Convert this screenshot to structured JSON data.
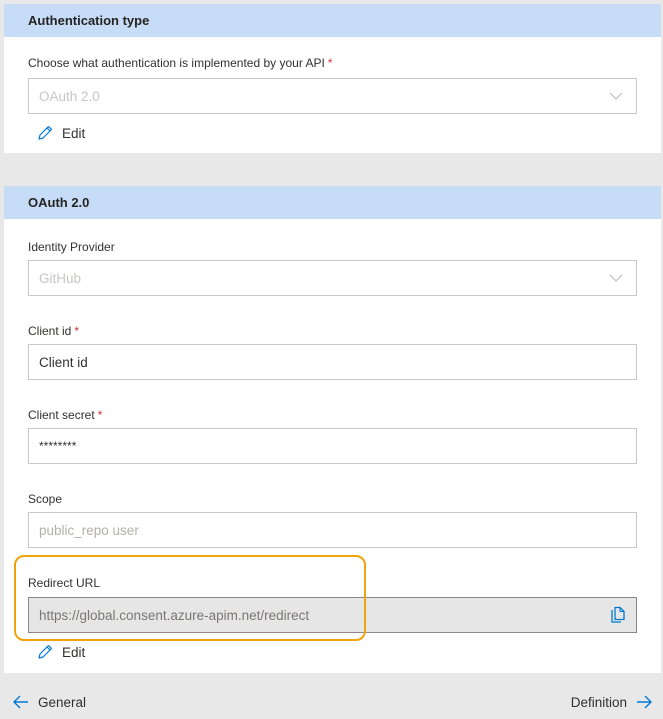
{
  "auth_section": {
    "title": "Authentication type",
    "label": "Choose what authentication is implemented by your API",
    "required_mark": "*",
    "selected_value": "OAuth 2.0",
    "edit_label": "Edit"
  },
  "oauth_section": {
    "title": "OAuth 2.0",
    "identity_provider": {
      "label": "Identity Provider",
      "value": "GitHub"
    },
    "client_id": {
      "label": "Client id",
      "required_mark": "*",
      "value": "Client id"
    },
    "client_secret": {
      "label": "Client secret",
      "required_mark": "*",
      "value": "********"
    },
    "scope": {
      "label": "Scope",
      "placeholder": "public_repo user"
    },
    "redirect_url": {
      "label": "Redirect URL",
      "value": "https://global.consent.azure-apim.net/redirect"
    },
    "edit_label": "Edit"
  },
  "footer": {
    "back_label": "General",
    "next_label": "Definition"
  },
  "colors": {
    "header_bg": "#c7dcf7",
    "highlight": "#f0a30a",
    "required": "#d13438",
    "accent": "#0078d4"
  },
  "icons": [
    "pencil-icon",
    "chevron-down-icon",
    "copy-icon",
    "arrow-left-icon",
    "arrow-right-icon"
  ]
}
